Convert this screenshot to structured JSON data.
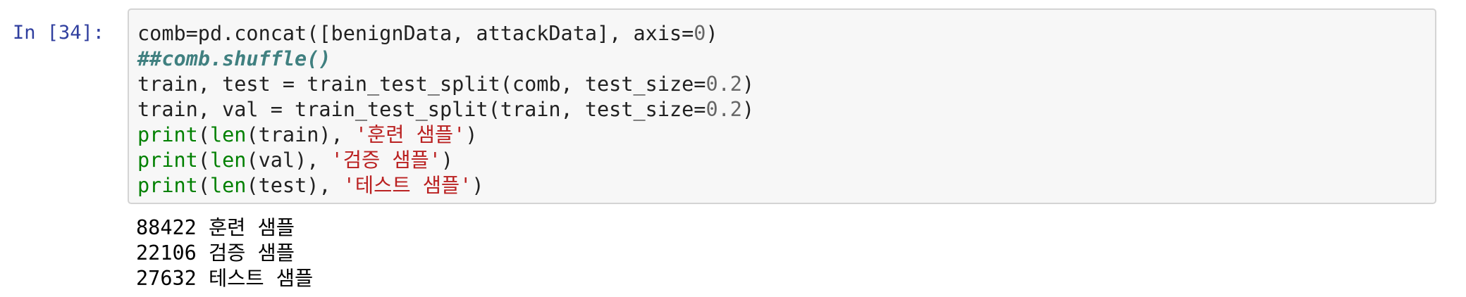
{
  "cell": {
    "prompt": "In [34]:",
    "code": {
      "line1": {
        "t1": "comb=pd.concat([benignData, attackData], axis=",
        "t2": "0",
        "t3": ")"
      },
      "line2": {
        "comment": "##comb.shuffle()"
      },
      "line3": {
        "t1": "train, test = train_test_split(comb, test_size=",
        "t2": "0.2",
        "t3": ")"
      },
      "line4": {
        "t1": "train, val = train_test_split(train, test_size=",
        "t2": "0.2",
        "t3": ")"
      },
      "line5": {
        "fn1": "print",
        "p1": "(",
        "fn2": "len",
        "mid": "(train), ",
        "str": "'훈련 샘플'",
        "end": ")"
      },
      "line6": {
        "fn1": "print",
        "p1": "(",
        "fn2": "len",
        "mid": "(val), ",
        "str": "'검증 샘플'",
        "end": ")"
      },
      "line7": {
        "fn1": "print",
        "p1": "(",
        "fn2": "len",
        "mid": "(test), ",
        "str": "'테스트 샘플'",
        "end": ")"
      }
    },
    "output": [
      "88422 훈련 샘플",
      "22106 검증 샘플",
      "27632 테스트 샘플"
    ]
  },
  "colors": {
    "prompt": "#303f9f",
    "builtin": "#008000",
    "string": "#ba2121",
    "comment": "#408080",
    "number": "#666666",
    "input_background": "#f7f7f7",
    "input_border": "#d4d4d4"
  }
}
